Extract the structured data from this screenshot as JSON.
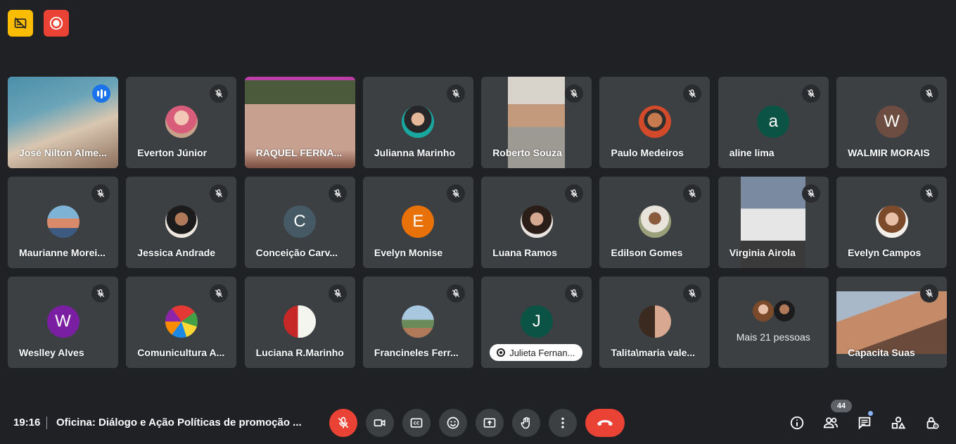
{
  "colors": {
    "background": "#202124",
    "tile": "#3c4043",
    "accent_blue": "#1a73e8",
    "danger": "#ea4335",
    "warning": "#fbbc04"
  },
  "top_badges": [
    {
      "icon": "no-subtitles-icon"
    },
    {
      "icon": "recording-icon"
    }
  ],
  "participants": [
    {
      "name": "José Nilton Alme...",
      "kind": "video",
      "speaking": true
    },
    {
      "name": "Everton Júnior",
      "kind": "photo"
    },
    {
      "name": "RAQUEL FERNA...",
      "kind": "video"
    },
    {
      "name": "Julianna Marinho",
      "kind": "photo"
    },
    {
      "name": "Roberto Souza",
      "kind": "video"
    },
    {
      "name": "Paulo Medeiros",
      "kind": "photo"
    },
    {
      "name": "aline lima",
      "kind": "initial",
      "initial": "a",
      "avatar_color": "#0b5345"
    },
    {
      "name": "WALMIR MORAIS",
      "kind": "initial",
      "initial": "W",
      "avatar_color": "#6d4c41"
    },
    {
      "name": "Maurianne Morei...",
      "kind": "photo"
    },
    {
      "name": "Jessica Andrade",
      "kind": "photo"
    },
    {
      "name": "Conceição Carv...",
      "kind": "initial",
      "initial": "C",
      "avatar_color": "#455a64"
    },
    {
      "name": "Evelyn Monise",
      "kind": "initial",
      "initial": "E",
      "avatar_color": "#e8710a"
    },
    {
      "name": "Luana Ramos",
      "kind": "photo"
    },
    {
      "name": "Edilson Gomes",
      "kind": "photo"
    },
    {
      "name": "Virginia Airola",
      "kind": "video"
    },
    {
      "name": "Evelyn Campos",
      "kind": "photo"
    },
    {
      "name": "Weslley Alves",
      "kind": "initial",
      "initial": "W",
      "avatar_color": "#7b1fa2"
    },
    {
      "name": "Comunicultura A...",
      "kind": "photo"
    },
    {
      "name": "Luciana R.Marinho",
      "kind": "photo"
    },
    {
      "name": "Francineles Ferr...",
      "kind": "photo"
    },
    {
      "name": "Julieta Fernan...",
      "kind": "initial",
      "initial": "J",
      "avatar_color": "#0b5345",
      "pill": true
    },
    {
      "name": "Talita\\maria vale...",
      "kind": "photo"
    },
    {
      "name": "Mais 21 pessoas",
      "kind": "more"
    },
    {
      "name": "Capacita Suas",
      "kind": "video"
    }
  ],
  "bottom_bar": {
    "time": "19:16",
    "meeting_title": "Oficina: Diálogo e Ação Políticas de promoção ...",
    "participant_count": "44",
    "controls": [
      {
        "name": "mic-off",
        "icon": "mic-off-icon"
      },
      {
        "name": "camera",
        "icon": "camera-icon"
      },
      {
        "name": "captions",
        "icon": "captions-icon"
      },
      {
        "name": "emoji",
        "icon": "emoji-icon"
      },
      {
        "name": "present",
        "icon": "present-icon"
      },
      {
        "name": "raise-hand",
        "icon": "hand-icon"
      },
      {
        "name": "more-options",
        "icon": "more-vert-icon"
      },
      {
        "name": "leave-call",
        "icon": "end-call-icon"
      }
    ],
    "right_icons": [
      "info-icon",
      "people-icon",
      "chat-icon",
      "activities-icon",
      "host-controls-icon"
    ]
  }
}
